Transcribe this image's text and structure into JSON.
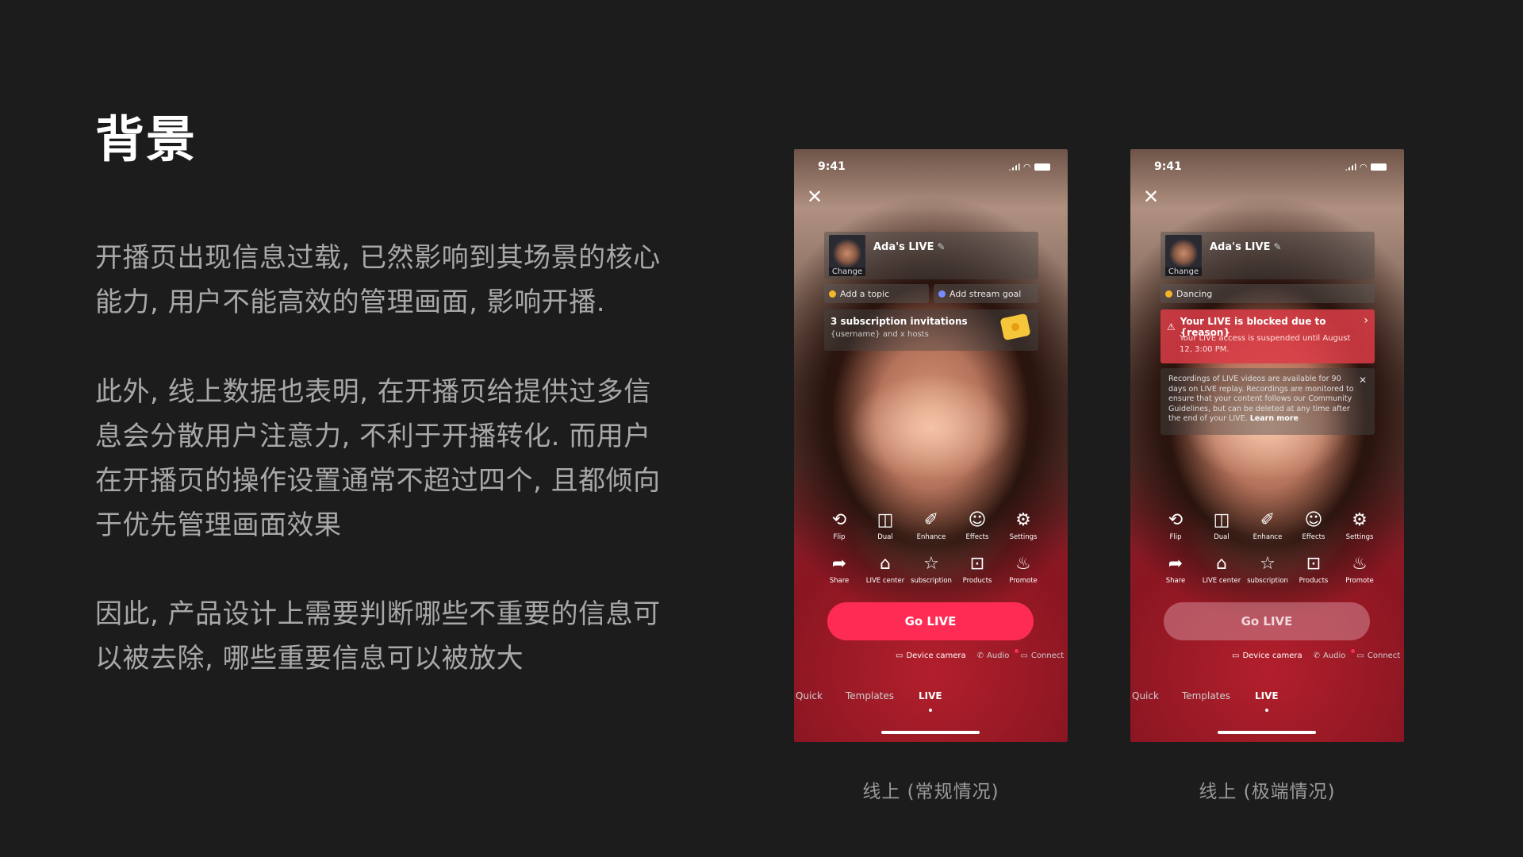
{
  "slide": {
    "title": "背景",
    "paragraphs": [
      "开播页出现信息过载, 已然影响到其场景的核心能力, 用户不能高效的管理画面, 影响开播.",
      "此外, 线上数据也表明, 在开播页给提供过多信息会分散用户注意力, 不利于开播转化. 而用户在开播页的操作设置通常不超过四个, 且都倾向于优先管理画面效果",
      "因此, 产品设计上需要判断哪些不重要的信息可以被去除, 哪些重要信息可以被放大"
    ]
  },
  "colors": {
    "background": "#1c1c1c",
    "accent": "#fe2c55",
    "alert": "#dc3c46",
    "body_text": "#a8a8a8"
  },
  "phones": {
    "left": {
      "caption": "线上 (常规情况)",
      "time": "9:41",
      "profile": {
        "name": "Ada's LIVE",
        "change_label": "Change"
      },
      "chips": {
        "topic": "Add a topic",
        "goal": "Add stream goal"
      },
      "subscription": {
        "title": "3 subscription invitations",
        "desc": "{username} and x hosts"
      },
      "tools_row1": [
        "Flip",
        "Dual",
        "Enhance",
        "Effects",
        "Settings"
      ],
      "tools_row2": [
        "Share",
        "LIVE center",
        "subscription",
        "Products",
        "Promote"
      ],
      "go_live": "Go LIVE",
      "sources": [
        "Device camera",
        "Audio",
        "Connect"
      ],
      "tabs": [
        "Quick",
        "Templates",
        "LIVE"
      ]
    },
    "right": {
      "caption": "线上 (极端情况)",
      "time": "9:41",
      "profile": {
        "name": "Ada's LIVE",
        "change_label": "Change"
      },
      "chips": {
        "topic": "Dancing"
      },
      "alert": {
        "title": "Your LIVE is blocked due to {reason}",
        "desc": "Your LIVE access is suspended until August 12, 3:00 PM."
      },
      "note": {
        "text": "Recordings of LIVE videos are available for 90 days on LIVE replay. Recordings are monitored to ensure that your content follows our Community Guidelines, but can be deleted at any time after the end of your LIVE.",
        "link": "Learn more"
      },
      "tools_row1": [
        "Flip",
        "Dual",
        "Enhance",
        "Effects",
        "Settings"
      ],
      "tools_row2": [
        "Share",
        "LIVE center",
        "subscription",
        "Products",
        "Promote"
      ],
      "go_live": "Go LIVE",
      "sources": [
        "Device camera",
        "Audio",
        "Connect"
      ],
      "tabs": [
        "Quick",
        "Templates",
        "LIVE"
      ]
    }
  },
  "icons": {
    "close": "close-icon",
    "flip": "flip-camera-icon",
    "dual": "dual-camera-icon",
    "enhance": "magic-wand-icon",
    "effects": "smiley-icon",
    "settings": "gear-icon",
    "share": "share-arrow-icon",
    "live_center": "house-play-icon",
    "subscription": "star-badge-icon",
    "products": "shopping-bag-icon",
    "promote": "flame-icon"
  }
}
